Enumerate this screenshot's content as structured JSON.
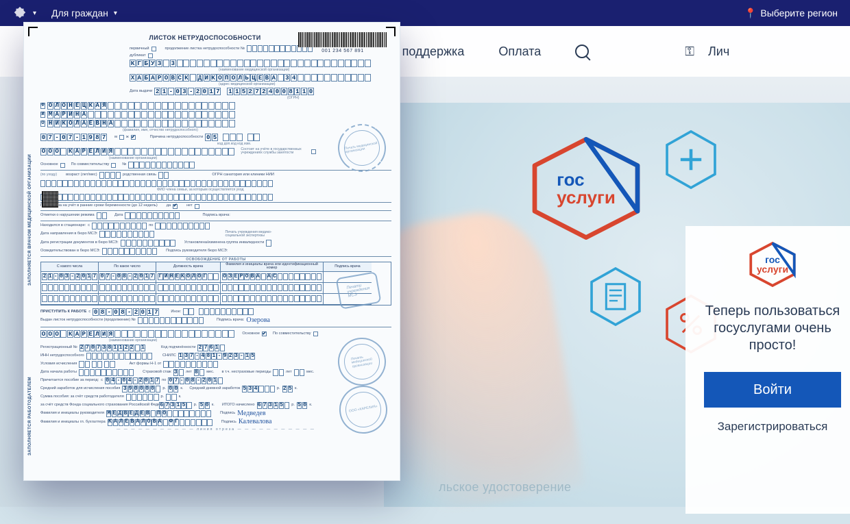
{
  "topbar": {
    "audience_label": "Для граждан",
    "region_label": "Выберите регион"
  },
  "menu": {
    "item_help": "мощь и поддержка",
    "item_pay": "Оплата",
    "item_account": "Лич"
  },
  "panel": {
    "brand_top": "гос",
    "brand_bottom": "услуги",
    "slogan": "Теперь пользоваться госуслугами очень просто!",
    "login": "Войти",
    "register": "Зарегистрироваться"
  },
  "big_logo": {
    "top": "гос",
    "bottom": "услуги"
  },
  "caption": "льское удостоверение",
  "doc": {
    "title": "ЛИСТОК НЕТРУДОСПОСОБНОСТИ",
    "barcode_number": "001 234 567 891",
    "lab_primary": "первичный",
    "lab_continuation": "продолжение листка нетрудоспособности №",
    "lab_duplicate": "дубликат",
    "org_name": "КГБУЗ 3",
    "org_addr": "ХАБАРОВСК ДИКОПОЛЬЦЕВА 34",
    "lab_issue_date": "Дата выдачи",
    "issue_date": "21-03-2017",
    "ogrn": "1152724008110",
    "surname_prefix": "Ф",
    "surname": "ОЛОНЕЦКАЯ",
    "name_prefix": "И",
    "name": "МАРИНА",
    "patronymic_prefix": "О",
    "patronymic": "НИКОЛАЕВНА",
    "lab_fio_note": "(фамилия, имя, отчество нетрудоспособного)",
    "dob": "07-07-1987",
    "lab_sex_m": "м",
    "lab_sex_f": "ж",
    "sex_checked": "f",
    "lab_cause": "Причина нетрудоспособности",
    "cause_code": "05",
    "lab_cause_sub": "код   доп.код    код изм.",
    "employer": "ООО КАРЕЛИЯ",
    "lab_employer_note": "(наименование организации)",
    "lab_on_register": "Состоит на учёте в государственных учреждениях службы занятости",
    "lab_main": "Основное",
    "lab_combine": "По совместительству",
    "lab_N": "№",
    "lab_care1": "(по уходу)",
    "lab_pregnancy": "Поставлена на учёт в ранние сроки беременности (до 12 недель)",
    "lab_yes": "да",
    "lab_no": "нет",
    "pregnancy_checked": "yes",
    "lab_violations": "Отметки о нарушении режима",
    "lab_date": "Дата",
    "lab_doctor_sign": "Подпись врача:",
    "lab_hospital": "Находился в стационаре:",
    "lab_from": "с",
    "lab_to": "по",
    "lab_mse_referral": "Дата направления в бюро МСЭ:",
    "lab_mse_docs": "Дата регистрации документов в бюро МСЭ:",
    "lab_mse_exam": "Освидетельствован в бюро МСЭ:",
    "lab_disability": "Установлена/изменена группа инвалидности",
    "lab_mse_head_sign": "Подпись руководителя бюро МСЭ:",
    "lab_inst_stamp": "Печать учреждения медико-социальной экспертизы",
    "table_title": "ОСВОБОЖДЕНИЕ ОТ РАБОТЫ",
    "table_headers": [
      "С какого числа",
      "По какое число",
      "Должность врача",
      "Фамилия и инициалы врача или идентификационный номер",
      "Подпись врача"
    ],
    "trow_from": "21-03-2017",
    "trow_to": "07-08-2017",
    "trow_pos": "ГИНЕКОЛОГ",
    "trow_doc": "ОЗЕРОВА АС",
    "lab_start_work": "ПРИСТУПИТЬ К РАБОТЕ",
    "start_work_date": "08-08-2017",
    "lab_other": "Иное:",
    "lab_issued_continuation": "Выдан листок нетрудоспособности (продолжение) №",
    "doctor_signature": "Озерова",
    "vl1": "ЗАПОЛНЯЕТСЯ ВРАЧОМ МЕДИЦИНСКОЙ ОРГАНИЗАЦИИ",
    "vl2": "ЗАПОЛНЯЕТСЯ РАБОТОДАТЕЛЕМ",
    "emp_name": "ООО КАРЕЛИЯ",
    "emp_main_checked": true,
    "lab_reg_no": "Регистрационный №",
    "reg_no": "2707381122 1",
    "lab_sub_code": "Код подчинённости",
    "sub_code": "2761",
    "lab_inn": "ИНН нетрудоспособного",
    "lab_snils": "СНИЛС",
    "snils": "137-481-923-15",
    "lab_conditions": "Условия исчисления",
    "lab_act": "Акт формы Н-1 от",
    "lab_start_date": "Дата начала работы",
    "lab_ins_years": "Страховой стаж",
    "years": "3",
    "lab_years": "лет",
    "months": "8",
    "lab_months": "мес.",
    "lab_nonins": "в т.ч. нестраховые периоды",
    "lab_nonins_y": "лет",
    "lab_nonins_m": "мес.",
    "lab_benefit_period": "Причитается пособие за период:",
    "benefit_from": "04-04-2017",
    "benefit_to": "07-08-201",
    "lab_avg_earn": "Средний заработок для исчисления пособия",
    "avg_earn_rub": "390000",
    "lab_rub": "р.",
    "avg_earn_kop": "00",
    "lab_kop": "к.",
    "lab_daily": "Средний дневной заработок",
    "daily_rub": "534",
    "daily_kop": "25",
    "lab_emp_sum": "Сумма пособия: за счёт средств работодателя",
    "lab_fss_sum": "за счёт средств Фонда социального страхования Российской Федерации",
    "fss_rub": "67315",
    "fss_kop": "50",
    "lab_total": "ИТОГО начислено",
    "total_rub": "67315",
    "total_kop": "50",
    "lab_head": "Фамилия и инициалы руководителя",
    "head_name": "МЕДВЕДЕВ ПО",
    "lab_sign": "Подпись",
    "head_signature": "Медведев",
    "lab_accountant": "Фамилия и инициалы гл. бухгалтера",
    "accountant_name": "КАЛЕВАЛОВА ФГ",
    "accountant_signature": "Калевалова",
    "lab_cut": "линия отреза",
    "stamp_org": "ООО «КАРЕЛИЯ»",
    "stamp_med": "Печать медицинской организации"
  }
}
